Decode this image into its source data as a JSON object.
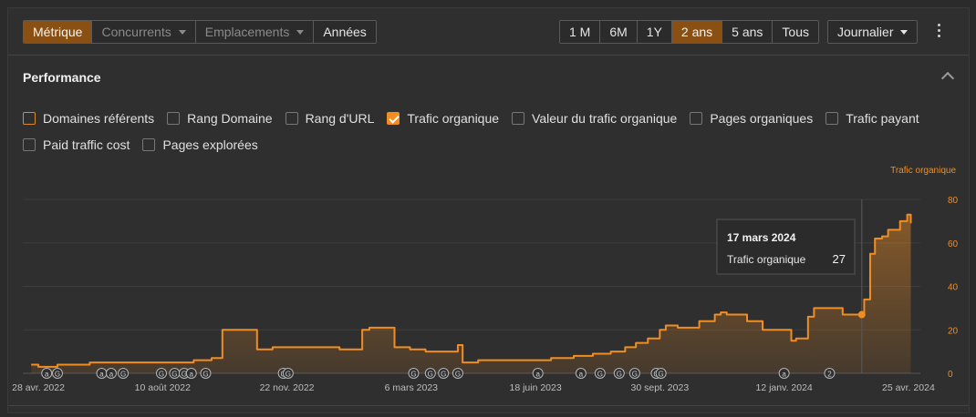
{
  "toolbar": {
    "metric_tabs": [
      {
        "label": "Métrique",
        "active": true,
        "disabled": false,
        "dropdown": false
      },
      {
        "label": "Concurrents",
        "active": false,
        "disabled": true,
        "dropdown": true
      },
      {
        "label": "Emplacements",
        "active": false,
        "disabled": true,
        "dropdown": true
      },
      {
        "label": "Années",
        "active": false,
        "disabled": false,
        "dropdown": false
      }
    ],
    "ranges": [
      {
        "label": "1 M",
        "active": false
      },
      {
        "label": "6M",
        "active": false
      },
      {
        "label": "1Y",
        "active": false
      },
      {
        "label": "2 ans",
        "active": true
      },
      {
        "label": "5 ans",
        "active": false
      },
      {
        "label": "Tous",
        "active": false
      }
    ],
    "granularity": "Journalier"
  },
  "section": {
    "title": "Performance"
  },
  "metrics": [
    {
      "label": "Domaines référents",
      "state": "outlined"
    },
    {
      "label": "Rang Domaine",
      "state": "off"
    },
    {
      "label": "Rang d'URL",
      "state": "off"
    },
    {
      "label": "Trafic organique",
      "state": "checked"
    },
    {
      "label": "Valeur du trafic organique",
      "state": "off"
    },
    {
      "label": "Pages organiques",
      "state": "off"
    },
    {
      "label": "Trafic payant",
      "state": "off"
    },
    {
      "label": "Paid traffic cost",
      "state": "off"
    },
    {
      "label": "Pages explorées",
      "state": "off"
    }
  ],
  "colors": {
    "series": "#f08d23",
    "accent": "#8a4f12",
    "axis": "#f08d23",
    "grid": "#3e3e3e"
  },
  "tooltip": {
    "date": "17 mars 2024",
    "label": "Trafic organique",
    "value": "27"
  },
  "chart_data": {
    "type": "line",
    "axis_title": "Trafic organique",
    "ylim": [
      0,
      80
    ],
    "yticks": [
      "80",
      "60",
      "40",
      "20",
      "0"
    ],
    "xlim": [
      "2022-04-15",
      "2024-05-05"
    ],
    "xticks": [
      {
        "label": "28 avr. 2022",
        "date": "2022-04-28"
      },
      {
        "label": "10 août 2022",
        "date": "2022-08-10"
      },
      {
        "label": "22 nov. 2022",
        "date": "2022-11-22"
      },
      {
        "label": "6 mars 2023",
        "date": "2023-03-06"
      },
      {
        "label": "18 juin 2023",
        "date": "2023-06-18"
      },
      {
        "label": "30 sept. 2023",
        "date": "2023-09-30"
      },
      {
        "label": "12 janv. 2024",
        "date": "2024-01-12"
      },
      {
        "label": "25 avr. 2024",
        "date": "2024-04-25"
      }
    ],
    "grid": true,
    "series": [
      {
        "name": "Trafic organique",
        "points": [
          [
            "2022-04-22",
            4
          ],
          [
            "2022-04-28",
            3
          ],
          [
            "2022-05-10",
            3
          ],
          [
            "2022-05-14",
            4
          ],
          [
            "2022-06-01",
            4
          ],
          [
            "2022-06-10",
            5
          ],
          [
            "2022-08-20",
            5
          ],
          [
            "2022-09-05",
            6
          ],
          [
            "2022-09-15",
            6
          ],
          [
            "2022-09-20",
            7
          ],
          [
            "2022-09-27",
            7
          ],
          [
            "2022-09-29",
            20
          ],
          [
            "2022-10-25",
            20
          ],
          [
            "2022-10-28",
            11
          ],
          [
            "2022-11-05",
            11
          ],
          [
            "2022-11-10",
            12
          ],
          [
            "2022-12-20",
            12
          ],
          [
            "2023-01-05",
            11
          ],
          [
            "2023-01-20",
            11
          ],
          [
            "2023-01-24",
            20
          ],
          [
            "2023-01-30",
            21
          ],
          [
            "2023-02-15",
            21
          ],
          [
            "2023-02-20",
            12
          ],
          [
            "2023-03-01",
            12
          ],
          [
            "2023-03-05",
            11
          ],
          [
            "2023-03-14",
            11
          ],
          [
            "2023-03-18",
            10
          ],
          [
            "2023-04-08",
            10
          ],
          [
            "2023-04-14",
            13
          ],
          [
            "2023-04-18",
            5
          ],
          [
            "2023-05-01",
            6
          ],
          [
            "2023-06-01",
            6
          ],
          [
            "2023-06-15",
            6
          ],
          [
            "2023-07-01",
            7
          ],
          [
            "2023-07-20",
            8
          ],
          [
            "2023-08-05",
            9
          ],
          [
            "2023-08-20",
            10
          ],
          [
            "2023-09-01",
            12
          ],
          [
            "2023-09-10",
            14
          ],
          [
            "2023-09-20",
            16
          ],
          [
            "2023-09-30",
            20
          ],
          [
            "2023-10-05",
            22
          ],
          [
            "2023-10-15",
            21
          ],
          [
            "2023-10-30",
            21
          ],
          [
            "2023-11-02",
            24
          ],
          [
            "2023-11-10",
            24
          ],
          [
            "2023-11-15",
            27
          ],
          [
            "2023-11-20",
            28
          ],
          [
            "2023-11-25",
            27
          ],
          [
            "2023-12-08",
            27
          ],
          [
            "2023-12-12",
            24
          ],
          [
            "2023-12-20",
            24
          ],
          [
            "2023-12-25",
            20
          ],
          [
            "2024-01-02",
            20
          ],
          [
            "2024-01-12",
            20
          ],
          [
            "2024-01-18",
            15
          ],
          [
            "2024-01-22",
            16
          ],
          [
            "2024-01-28",
            16
          ],
          [
            "2024-02-01",
            26
          ],
          [
            "2024-02-06",
            30
          ],
          [
            "2024-02-28",
            30
          ],
          [
            "2024-03-01",
            27
          ],
          [
            "2024-03-17",
            27
          ],
          [
            "2024-03-19",
            34
          ],
          [
            "2024-03-24",
            55
          ],
          [
            "2024-03-28",
            62
          ],
          [
            "2024-04-03",
            63
          ],
          [
            "2024-04-08",
            66
          ],
          [
            "2024-04-14",
            66
          ],
          [
            "2024-04-18",
            70
          ],
          [
            "2024-04-24",
            73
          ],
          [
            "2024-04-27",
            69
          ]
        ]
      }
    ],
    "hover": {
      "date": "2024-03-17",
      "value": 27
    },
    "annotations": [
      {
        "date": "2022-05-05",
        "marker": "a"
      },
      {
        "date": "2022-05-14",
        "marker": "G"
      },
      {
        "date": "2022-06-20",
        "marker": "a"
      },
      {
        "date": "2022-06-28",
        "marker": "a"
      },
      {
        "date": "2022-07-08",
        "marker": "G"
      },
      {
        "date": "2022-08-09",
        "marker": "G"
      },
      {
        "date": "2022-08-20",
        "marker": "G"
      },
      {
        "date": "2022-08-28",
        "marker": "G"
      },
      {
        "date": "2022-09-03",
        "marker": "a"
      },
      {
        "date": "2022-09-15",
        "marker": "G"
      },
      {
        "date": "2022-11-19",
        "marker": "G"
      },
      {
        "date": "2022-11-23",
        "marker": "G"
      },
      {
        "date": "2023-03-08",
        "marker": "G"
      },
      {
        "date": "2023-03-22",
        "marker": "G"
      },
      {
        "date": "2023-04-02",
        "marker": "G"
      },
      {
        "date": "2023-04-14",
        "marker": "G"
      },
      {
        "date": "2023-06-20",
        "marker": "a"
      },
      {
        "date": "2023-07-26",
        "marker": "a"
      },
      {
        "date": "2023-08-11",
        "marker": "G"
      },
      {
        "date": "2023-08-27",
        "marker": "G"
      },
      {
        "date": "2023-09-09",
        "marker": "G"
      },
      {
        "date": "2023-09-27",
        "marker": "G"
      },
      {
        "date": "2023-10-01",
        "marker": "G"
      },
      {
        "date": "2024-01-12",
        "marker": "a"
      },
      {
        "date": "2024-02-19",
        "marker": "2"
      }
    ]
  }
}
